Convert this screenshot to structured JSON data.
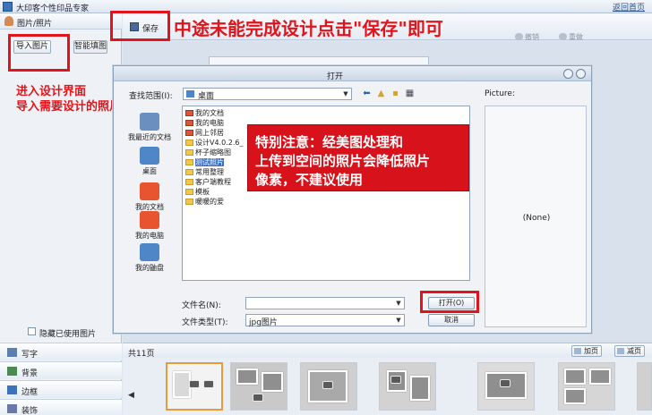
{
  "app": {
    "title": "大印客个性印品专家",
    "back_home": "返回首页"
  },
  "left": {
    "header": "图片/照片",
    "import_button": "导入图片",
    "smart_fill_button": "智能填图",
    "hide_used_label": "隐藏已使用图片",
    "tabs": [
      {
        "label": "写字",
        "icon": "text-icon"
      },
      {
        "label": "背景",
        "icon": "background-icon"
      },
      {
        "label": "边框",
        "icon": "frame-icon"
      },
      {
        "label": "装饰",
        "icon": "decoration-icon"
      }
    ]
  },
  "toolbar": {
    "save_label": "保存",
    "undo_label": "撤销",
    "redo_label": "重做"
  },
  "annotations": {
    "save_tip": "中途未能完成设计点击\"保存\"即可",
    "import_tip_line1": "进入设计界面",
    "import_tip_line2": "导入需要设计的照片",
    "warning_line1": "特别注意：经美图处理和",
    "warning_line2": "上传到空间的照片会降低照片",
    "warning_line3": "像素，不建议使用"
  },
  "dialog": {
    "title": "打开",
    "look_in_label": "查找范围(I):",
    "look_in_value": "桌面",
    "picture_label": "Picture:",
    "preview_none": "(None)",
    "places": [
      {
        "label": "我最近的文档",
        "icon": "recent-icon",
        "color": "#6b8fbf"
      },
      {
        "label": "桌面",
        "icon": "desktop-icon",
        "color": "#4f86c8"
      },
      {
        "label": "我的文档",
        "icon": "my-documents-icon",
        "color": "#e8542f"
      },
      {
        "label": "我的电脑",
        "icon": "my-computer-icon",
        "color": "#e8542f"
      },
      {
        "label": "我的鼬盘",
        "icon": "network-icon",
        "color": "#4f86c8"
      }
    ],
    "files": [
      {
        "name": "我的文档",
        "type": "sys"
      },
      {
        "name": "我的电脑",
        "type": "sys"
      },
      {
        "name": "网上邻居",
        "type": "sys"
      },
      {
        "name": "设计V4.0.2.6_",
        "type": "folder"
      },
      {
        "name": "杯子缩略图",
        "type": "folder"
      },
      {
        "name": "测试照片",
        "type": "folder",
        "selected": true
      },
      {
        "name": "常用整理",
        "type": "folder"
      },
      {
        "name": "客户端教程",
        "type": "folder"
      },
      {
        "name": "模板",
        "type": "folder"
      },
      {
        "name": "暖暖的爱",
        "type": "folder"
      }
    ],
    "filename_label": "文件名(N):",
    "filename_value": "",
    "filetype_label": "文件类型(T):",
    "filetype_value": "jpg图片",
    "open_button": "打开(O)",
    "cancel_button": "取消"
  },
  "pages": {
    "count_label": "共11页",
    "add_button": "加页",
    "remove_button": "减页"
  },
  "colors": {
    "highlight_red": "#e0141a",
    "warning_bg": "#d7121b",
    "selection_blue": "#3a6fc4",
    "active_thumb": "#e89b3a"
  }
}
